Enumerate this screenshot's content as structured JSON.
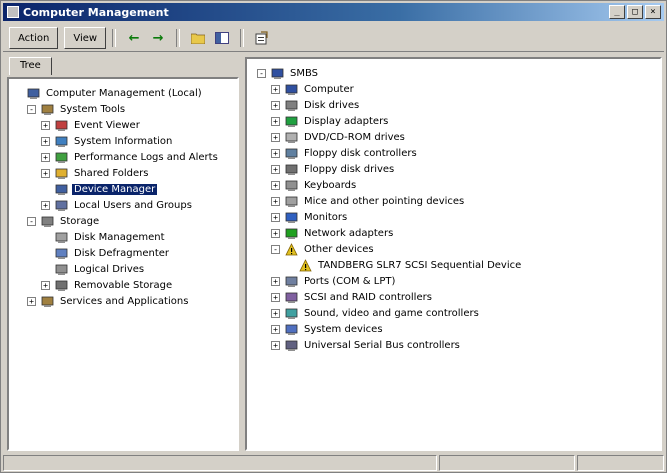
{
  "window": {
    "title": "Computer Management"
  },
  "window_buttons": {
    "minimize": "_",
    "maximize": "□",
    "close": "×"
  },
  "toolbar": {
    "action": "Action",
    "view": "View",
    "back": "←",
    "forward": "→"
  },
  "tabs": {
    "tree": "Tree"
  },
  "left_tree": [
    {
      "label": "Computer Management (Local)",
      "level": 0,
      "icon": "computer-management-icon",
      "exp": "none"
    },
    {
      "label": "System Tools",
      "level": 1,
      "icon": "toolbox-icon",
      "exp": "-"
    },
    {
      "label": "Event Viewer",
      "level": 2,
      "icon": "event-viewer-icon",
      "exp": "+"
    },
    {
      "label": "System Information",
      "level": 2,
      "icon": "system-information-icon",
      "exp": "+"
    },
    {
      "label": "Performance Logs and Alerts",
      "level": 2,
      "icon": "performance-icon",
      "exp": "+"
    },
    {
      "label": "Shared Folders",
      "level": 2,
      "icon": "shared-folder-icon",
      "exp": "+"
    },
    {
      "label": "Device Manager",
      "level": 2,
      "icon": "device-manager-icon",
      "exp": "none",
      "selected": true
    },
    {
      "label": "Local Users and Groups",
      "level": 2,
      "icon": "users-icon",
      "exp": "+"
    },
    {
      "label": "Storage",
      "level": 1,
      "icon": "storage-icon",
      "exp": "-"
    },
    {
      "label": "Disk Management",
      "level": 2,
      "icon": "disk-management-icon",
      "exp": "none"
    },
    {
      "label": "Disk Defragmenter",
      "level": 2,
      "icon": "defragmenter-icon",
      "exp": "none"
    },
    {
      "label": "Logical Drives",
      "level": 2,
      "icon": "logical-drives-icon",
      "exp": "none"
    },
    {
      "label": "Removable Storage",
      "level": 2,
      "icon": "removable-storage-icon",
      "exp": "+"
    },
    {
      "label": "Services and Applications",
      "level": 1,
      "icon": "services-icon",
      "exp": "+"
    }
  ],
  "right_tree": [
    {
      "label": "SMBS",
      "level": 0,
      "icon": "computer-icon",
      "exp": "-"
    },
    {
      "label": "Computer",
      "level": 1,
      "icon": "computer-icon",
      "exp": "+"
    },
    {
      "label": "Disk drives",
      "level": 1,
      "icon": "disk-drive-icon",
      "exp": "+"
    },
    {
      "label": "Display adapters",
      "level": 1,
      "icon": "display-adapter-icon",
      "exp": "+"
    },
    {
      "label": "DVD/CD-ROM drives",
      "level": 1,
      "icon": "dvd-cdrom-icon",
      "exp": "+"
    },
    {
      "label": "Floppy disk controllers",
      "level": 1,
      "icon": "floppy-controller-icon",
      "exp": "+"
    },
    {
      "label": "Floppy disk drives",
      "level": 1,
      "icon": "floppy-drive-icon",
      "exp": "+"
    },
    {
      "label": "Keyboards",
      "level": 1,
      "icon": "keyboard-icon",
      "exp": "+"
    },
    {
      "label": "Mice and other pointing devices",
      "level": 1,
      "icon": "mouse-icon",
      "exp": "+"
    },
    {
      "label": "Monitors",
      "level": 1,
      "icon": "monitor-icon",
      "exp": "+"
    },
    {
      "label": "Network adapters",
      "level": 1,
      "icon": "network-adapter-icon",
      "exp": "+"
    },
    {
      "label": "Other devices",
      "level": 1,
      "icon": "question-device-icon",
      "exp": "-"
    },
    {
      "label": "TANDBERG SLR7 SCSI Sequential Device",
      "level": 2,
      "icon": "warning-device-icon",
      "exp": "none"
    },
    {
      "label": "Ports (COM & LPT)",
      "level": 1,
      "icon": "port-icon",
      "exp": "+"
    },
    {
      "label": "SCSI and RAID controllers",
      "level": 1,
      "icon": "scsi-controller-icon",
      "exp": "+"
    },
    {
      "label": "Sound, video and game controllers",
      "level": 1,
      "icon": "sound-icon",
      "exp": "+"
    },
    {
      "label": "System devices",
      "level": 1,
      "icon": "system-device-icon",
      "exp": "+"
    },
    {
      "label": "Universal Serial Bus controllers",
      "level": 1,
      "icon": "usb-icon",
      "exp": "+"
    }
  ],
  "colors": {
    "titlebar_start": "#0a246a",
    "titlebar_end": "#a6caf0",
    "selection": "#0a246a",
    "face": "#d4d0c8"
  }
}
